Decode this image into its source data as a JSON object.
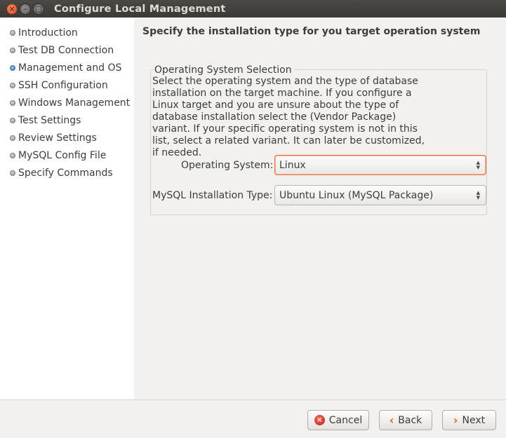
{
  "window": {
    "title": "Configure Local Management"
  },
  "sidebar": {
    "steps": [
      {
        "label": "Introduction",
        "state": "done"
      },
      {
        "label": "Test DB Connection",
        "state": "done"
      },
      {
        "label": "Management and OS",
        "state": "current"
      },
      {
        "label": "SSH Configuration",
        "state": "todo"
      },
      {
        "label": "Windows Management",
        "state": "todo"
      },
      {
        "label": "Test Settings",
        "state": "todo"
      },
      {
        "label": "Review Settings",
        "state": "todo"
      },
      {
        "label": "MySQL Config File",
        "state": "todo"
      },
      {
        "label": "Specify Commands",
        "state": "todo"
      }
    ]
  },
  "main": {
    "heading": "Specify the installation type for you target operation system",
    "group": {
      "title": "Operating System Selection",
      "description": "Select the operating system and the type of database installation on the target machine. If you configure a Linux target and you are unsure about the type of database installation select the (Vendor Package) variant. If your specific operating system is not in this list, select a related variant. It can later be customized, if needed.",
      "os_label": "Operating System:",
      "os_value": "Linux",
      "install_label": "MySQL Installation Type:",
      "install_value": "Ubuntu Linux (MySQL Package)"
    }
  },
  "buttons": {
    "cancel": "Cancel",
    "back": "Back",
    "next": "Next"
  },
  "icons": {
    "close": "close-icon",
    "minimize": "minimize-icon",
    "maximize": "maximize-icon",
    "cancel": "cancel-icon",
    "back": "chevron-left-icon",
    "next": "chevron-right-icon"
  },
  "colors": {
    "accent": "#e9744a",
    "current_step": "#3f7fc2",
    "titlebar": "#3b3a36"
  }
}
